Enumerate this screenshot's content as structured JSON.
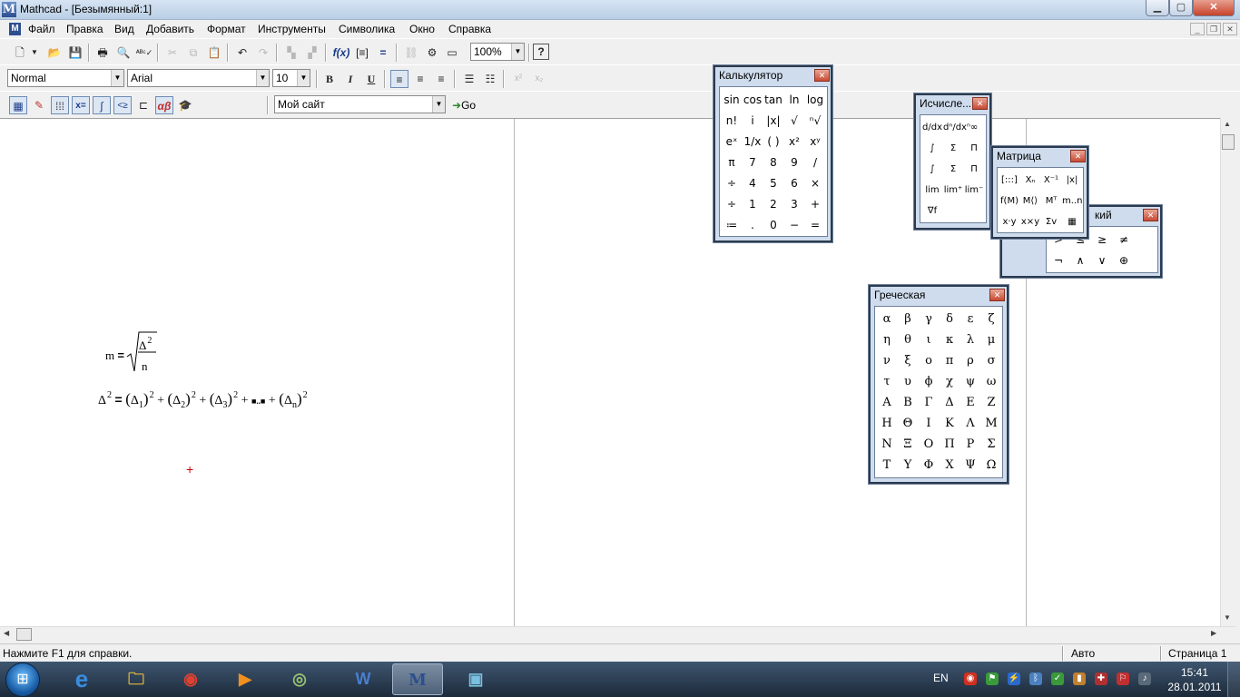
{
  "window": {
    "title": "Mathcad - [Безымянный:1]",
    "minimize": "▁",
    "maximize": "▢",
    "close": "✕"
  },
  "menu": {
    "items": [
      "Файл",
      "Правка",
      "Вид",
      "Добавить",
      "Формат",
      "Инструменты",
      "Символика",
      "Окно",
      "Справка"
    ]
  },
  "toolbar_standard": {
    "zoom": "100%"
  },
  "toolbar_format": {
    "style": "Normal",
    "font": "Arial",
    "size": "10",
    "bold": "B",
    "italic": "I",
    "underline": "U"
  },
  "toolbar_resources": {
    "site": "Мой сайт",
    "go": "Go"
  },
  "document": {
    "eq1": {
      "lhs": "m",
      "sym": "Δ",
      "exp": "2",
      "den": "n"
    },
    "eq2": {
      "lhs": "Δ",
      "exp": "2",
      "terms": [
        "Δ",
        "Δ",
        "Δ",
        "Δ"
      ],
      "subs": [
        "1",
        "2",
        "3",
        "n"
      ],
      "ellipsis": "■..■"
    }
  },
  "palettes": {
    "calculator": {
      "title": "Калькулятор",
      "buttons": [
        "sin",
        "cos",
        "tan",
        "ln",
        "log",
        "n!",
        "i",
        "|x|",
        "√",
        "ⁿ√",
        "eˣ",
        "1/x",
        "( )",
        "x²",
        "xʸ",
        "π",
        "7",
        "8",
        "9",
        "/",
        "÷",
        "4",
        "5",
        "6",
        "×",
        "÷",
        "1",
        "2",
        "3",
        "+",
        "≔",
        ".",
        "0",
        "−",
        "="
      ]
    },
    "calculus": {
      "title": "Исчисле...",
      "buttons": [
        "d/dx",
        "dⁿ/dxⁿ",
        "∞",
        "∫",
        "Σ",
        "Π",
        "∫",
        "Σ",
        "Π",
        "lim",
        "lim⁺",
        "lim⁻",
        "∇f"
      ]
    },
    "matrix": {
      "title": "Матрица",
      "buttons": [
        "[:::]",
        "Xₙ",
        "X⁻¹",
        "|x|",
        "f(M)",
        "M⟨⟩",
        "Mᵀ",
        "m..n",
        "x·y",
        "x×y",
        "Σv",
        "▦"
      ]
    },
    "boolean": {
      "title": "кий",
      "buttons": [
        ">",
        "≤",
        "≥",
        "≠",
        "¬",
        "∧",
        "∨",
        "⊕"
      ]
    },
    "greek": {
      "title": "Греческая",
      "letters": [
        "α",
        "β",
        "γ",
        "δ",
        "ε",
        "ζ",
        "η",
        "θ",
        "ι",
        "κ",
        "λ",
        "μ",
        "ν",
        "ξ",
        "ο",
        "π",
        "ρ",
        "σ",
        "τ",
        "υ",
        "ϕ",
        "χ",
        "ψ",
        "ω",
        "Α",
        "Β",
        "Γ",
        "Δ",
        "Ε",
        "Ζ",
        "Η",
        "Θ",
        "Ι",
        "Κ",
        "Λ",
        "Μ",
        "Ν",
        "Ξ",
        "Ο",
        "Π",
        "Ρ",
        "Σ",
        "Τ",
        "Υ",
        "Φ",
        "Χ",
        "Ψ",
        "Ω"
      ]
    }
  },
  "status": {
    "help": "Нажмите F1 для справки.",
    "mode": "Авто",
    "page": "Страница 1"
  },
  "taskbar": {
    "lang": "EN",
    "time": "15:41",
    "date": "28.01.2011"
  }
}
